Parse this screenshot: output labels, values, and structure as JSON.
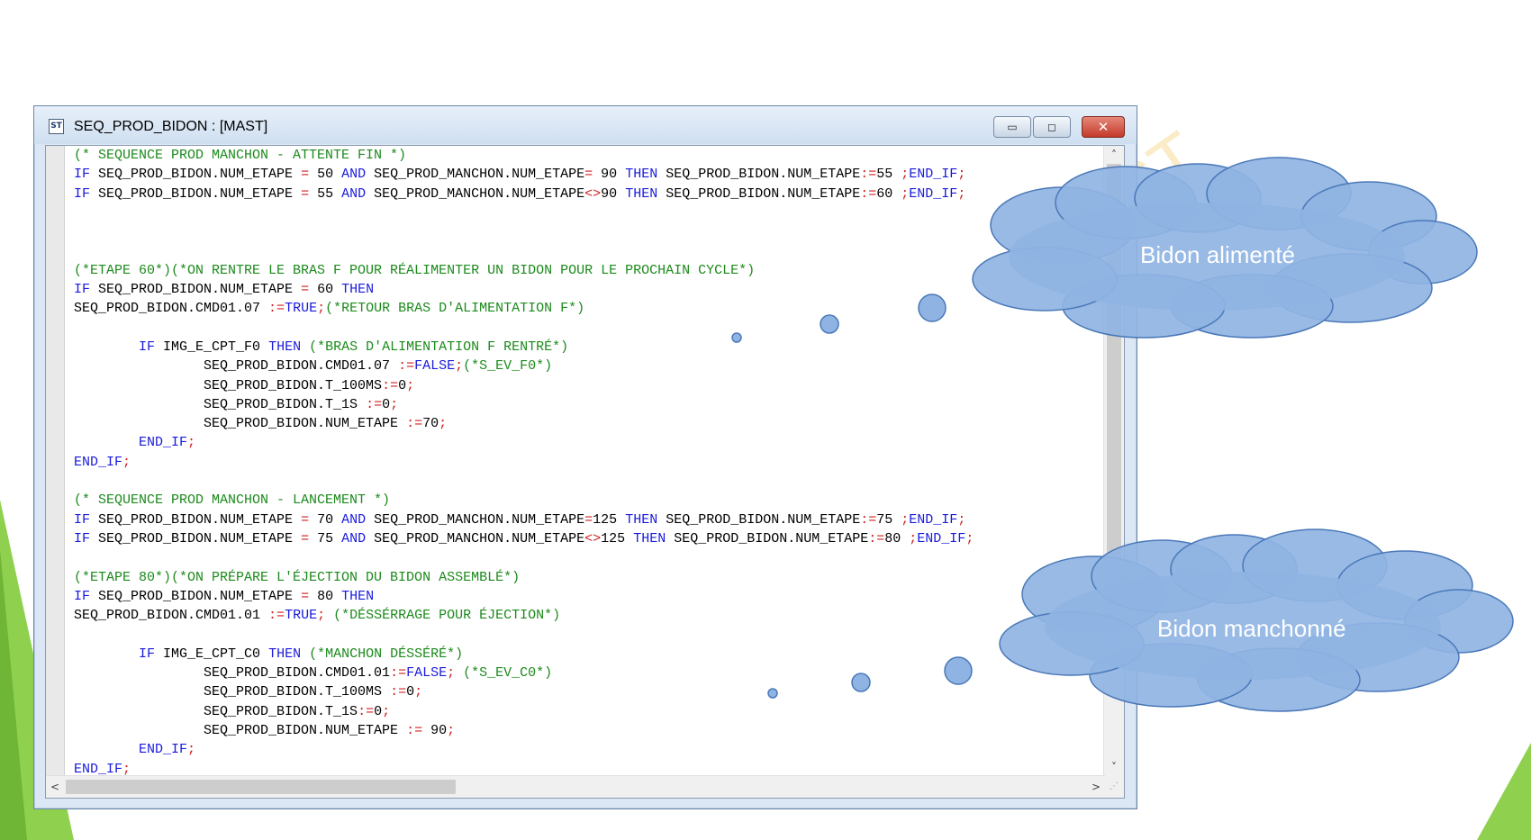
{
  "window": {
    "title": "SEQ_PROD_BIDON : [MAST]",
    "icon_label": "ST",
    "minimize_label": "▭",
    "maximize_label": "◻",
    "close_label": "✕"
  },
  "code": {
    "lines": [
      [
        {
          "t": "(* SEQUENCE PROD MANCHON - ATTENTE FIN *)",
          "c": "cm"
        }
      ],
      [
        {
          "t": "IF",
          "c": "kw"
        },
        {
          "t": " SEQ_PROD_BIDON.NUM_ETAPE "
        },
        {
          "t": "=",
          "c": "op"
        },
        {
          "t": " 50 "
        },
        {
          "t": "AND",
          "c": "kw"
        },
        {
          "t": " SEQ_PROD_MANCHON.NUM_ETAPE"
        },
        {
          "t": "=",
          "c": "op"
        },
        {
          "t": " 90 "
        },
        {
          "t": "THEN",
          "c": "kw"
        },
        {
          "t": " SEQ_PROD_BIDON.NUM_ETAPE"
        },
        {
          "t": ":=",
          "c": "op"
        },
        {
          "t": "55 "
        },
        {
          "t": ";",
          "c": "op"
        },
        {
          "t": "END_IF",
          "c": "kw"
        },
        {
          "t": ";",
          "c": "op"
        }
      ],
      [
        {
          "t": "IF",
          "c": "kw"
        },
        {
          "t": " SEQ_PROD_BIDON.NUM_ETAPE "
        },
        {
          "t": "=",
          "c": "op"
        },
        {
          "t": " 55 "
        },
        {
          "t": "AND",
          "c": "kw"
        },
        {
          "t": " SEQ_PROD_MANCHON.NUM_ETAPE"
        },
        {
          "t": "<>",
          "c": "op"
        },
        {
          "t": "90 "
        },
        {
          "t": "THEN",
          "c": "kw"
        },
        {
          "t": " SEQ_PROD_BIDON.NUM_ETAPE"
        },
        {
          "t": ":=",
          "c": "op"
        },
        {
          "t": "60 "
        },
        {
          "t": ";",
          "c": "op"
        },
        {
          "t": "END_IF",
          "c": "kw"
        },
        {
          "t": ";",
          "c": "op"
        }
      ],
      [],
      [],
      [],
      [
        {
          "t": "(*ETAPE 60*)(*ON RENTRE LE BRAS F POUR RÉALIMENTER UN BIDON POUR LE PROCHAIN CYCLE*)",
          "c": "cm"
        }
      ],
      [
        {
          "t": "IF",
          "c": "kw"
        },
        {
          "t": " SEQ_PROD_BIDON.NUM_ETAPE "
        },
        {
          "t": "=",
          "c": "op"
        },
        {
          "t": " 60 "
        },
        {
          "t": "THEN",
          "c": "kw"
        }
      ],
      [
        {
          "t": "SEQ_PROD_BIDON.CMD01.07 "
        },
        {
          "t": ":=",
          "c": "op"
        },
        {
          "t": "TRUE",
          "c": "kw"
        },
        {
          "t": ";",
          "c": "op"
        },
        {
          "t": "(*RETOUR BRAS D'ALIMENTATION F*)",
          "c": "cm"
        }
      ],
      [],
      [
        {
          "t": "        "
        },
        {
          "t": "IF",
          "c": "kw"
        },
        {
          "t": " IMG_E_CPT_F0 "
        },
        {
          "t": "THEN",
          "c": "kw"
        },
        {
          "t": " "
        },
        {
          "t": "(*BRAS D'ALIMENTATION F RENTRÉ*)",
          "c": "cm"
        }
      ],
      [
        {
          "t": "                SEQ_PROD_BIDON.CMD01.07 "
        },
        {
          "t": ":=",
          "c": "op"
        },
        {
          "t": "FALSE",
          "c": "kw"
        },
        {
          "t": ";",
          "c": "op"
        },
        {
          "t": "(*S_EV_F0*)",
          "c": "cm"
        }
      ],
      [
        {
          "t": "                SEQ_PROD_BIDON.T_100MS"
        },
        {
          "t": ":=",
          "c": "op"
        },
        {
          "t": "0"
        },
        {
          "t": ";",
          "c": "op"
        }
      ],
      [
        {
          "t": "                SEQ_PROD_BIDON.T_1S "
        },
        {
          "t": ":=",
          "c": "op"
        },
        {
          "t": "0"
        },
        {
          "t": ";",
          "c": "op"
        }
      ],
      [
        {
          "t": "                SEQ_PROD_BIDON.NUM_ETAPE "
        },
        {
          "t": ":=",
          "c": "op"
        },
        {
          "t": "70"
        },
        {
          "t": ";",
          "c": "op"
        }
      ],
      [
        {
          "t": "        "
        },
        {
          "t": "END_IF",
          "c": "kw"
        },
        {
          "t": ";",
          "c": "op"
        }
      ],
      [
        {
          "t": "END_IF",
          "c": "kw"
        },
        {
          "t": ";",
          "c": "op"
        }
      ],
      [],
      [
        {
          "t": "(* SEQUENCE PROD MANCHON - LANCEMENT *)",
          "c": "cm"
        }
      ],
      [
        {
          "t": "IF",
          "c": "kw"
        },
        {
          "t": " SEQ_PROD_BIDON.NUM_ETAPE "
        },
        {
          "t": "=",
          "c": "op"
        },
        {
          "t": " 70 "
        },
        {
          "t": "AND",
          "c": "kw"
        },
        {
          "t": " SEQ_PROD_MANCHON.NUM_ETAPE"
        },
        {
          "t": "=",
          "c": "op"
        },
        {
          "t": "125 "
        },
        {
          "t": "THEN",
          "c": "kw"
        },
        {
          "t": " SEQ_PROD_BIDON.NUM_ETAPE"
        },
        {
          "t": ":=",
          "c": "op"
        },
        {
          "t": "75 "
        },
        {
          "t": ";",
          "c": "op"
        },
        {
          "t": "END_IF",
          "c": "kw"
        },
        {
          "t": ";",
          "c": "op"
        }
      ],
      [
        {
          "t": "IF",
          "c": "kw"
        },
        {
          "t": " SEQ_PROD_BIDON.NUM_ETAPE "
        },
        {
          "t": "=",
          "c": "op"
        },
        {
          "t": " 75 "
        },
        {
          "t": "AND",
          "c": "kw"
        },
        {
          "t": " SEQ_PROD_MANCHON.NUM_ETAPE"
        },
        {
          "t": "<>",
          "c": "op"
        },
        {
          "t": "125 "
        },
        {
          "t": "THEN",
          "c": "kw"
        },
        {
          "t": " SEQ_PROD_BIDON.NUM_ETAPE"
        },
        {
          "t": ":=",
          "c": "op"
        },
        {
          "t": "80 "
        },
        {
          "t": ";",
          "c": "op"
        },
        {
          "t": "END_IF",
          "c": "kw"
        },
        {
          "t": ";",
          "c": "op"
        }
      ],
      [],
      [
        {
          "t": "(*ETAPE 80*)(*ON PRÉPARE L'ÉJECTION DU BIDON ASSEMBLÉ*)",
          "c": "cm"
        }
      ],
      [
        {
          "t": "IF",
          "c": "kw"
        },
        {
          "t": " SEQ_PROD_BIDON.NUM_ETAPE "
        },
        {
          "t": "=",
          "c": "op"
        },
        {
          "t": " 80 "
        },
        {
          "t": "THEN",
          "c": "kw"
        }
      ],
      [
        {
          "t": "SEQ_PROD_BIDON.CMD01.01 "
        },
        {
          "t": ":=",
          "c": "op"
        },
        {
          "t": "TRUE",
          "c": "kw"
        },
        {
          "t": ";",
          "c": "op"
        },
        {
          "t": " "
        },
        {
          "t": "(*DÉSSÉRRAGE POUR ÉJECTION*)",
          "c": "cm"
        }
      ],
      [],
      [
        {
          "t": "        "
        },
        {
          "t": "IF",
          "c": "kw"
        },
        {
          "t": " IMG_E_CPT_C0 "
        },
        {
          "t": "THEN",
          "c": "kw"
        },
        {
          "t": " "
        },
        {
          "t": "(*MANCHON DÉSSÉRÉ*)",
          "c": "cm"
        }
      ],
      [
        {
          "t": "                SEQ_PROD_BIDON.CMD01.01"
        },
        {
          "t": ":=",
          "c": "op"
        },
        {
          "t": "FALSE",
          "c": "kw"
        },
        {
          "t": ";",
          "c": "op"
        },
        {
          "t": " "
        },
        {
          "t": "(*S_EV_C0*)",
          "c": "cm"
        }
      ],
      [
        {
          "t": "                SEQ_PROD_BIDON.T_100MS "
        },
        {
          "t": ":=",
          "c": "op"
        },
        {
          "t": "0"
        },
        {
          "t": ";",
          "c": "op"
        }
      ],
      [
        {
          "t": "                SEQ_PROD_BIDON.T_1S"
        },
        {
          "t": ":=",
          "c": "op"
        },
        {
          "t": "0"
        },
        {
          "t": ";",
          "c": "op"
        }
      ],
      [
        {
          "t": "                SEQ_PROD_BIDON.NUM_ETAPE "
        },
        {
          "t": ":=",
          "c": "op"
        },
        {
          "t": " 90"
        },
        {
          "t": ";",
          "c": "op"
        }
      ],
      [
        {
          "t": "        "
        },
        {
          "t": "END_IF",
          "c": "kw"
        },
        {
          "t": ";",
          "c": "op"
        }
      ],
      [
        {
          "t": "END_IF",
          "c": "kw"
        },
        {
          "t": ";",
          "c": "op"
        }
      ]
    ]
  },
  "callouts": {
    "top": "Bidon alimenté",
    "bottom": "Bidon manchonné"
  },
  "watermark": "ST",
  "colors": {
    "keyword": "#1a1adc",
    "comment": "#1c8a1c",
    "operator": "#d02020",
    "cloud_fill": "#8fb4e3",
    "cloud_stroke": "#4a78b8",
    "slide_accent": "#8fd14f"
  }
}
